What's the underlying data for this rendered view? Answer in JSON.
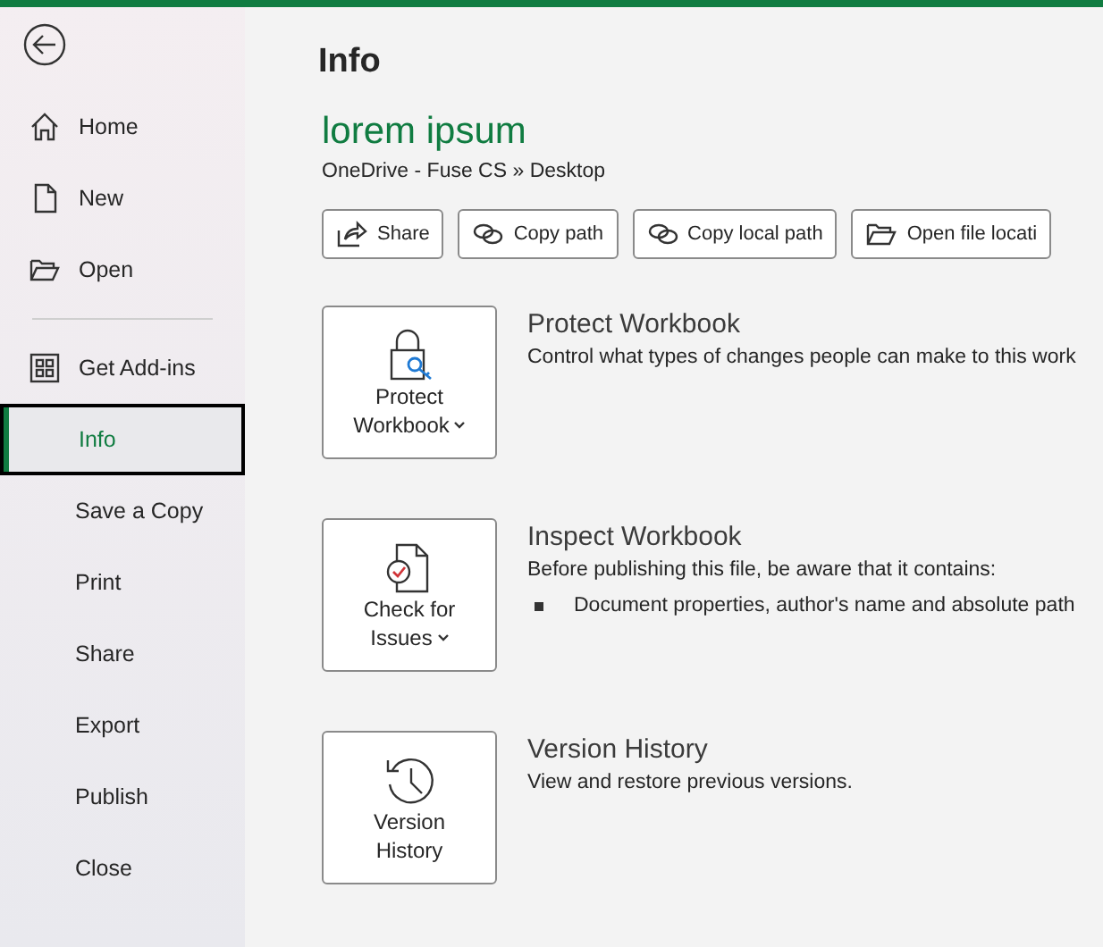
{
  "sidebar": {
    "items": [
      {
        "label": "Home",
        "selected": false
      },
      {
        "label": "New",
        "selected": false
      },
      {
        "label": "Open",
        "selected": false
      },
      {
        "kind": "divider"
      },
      {
        "label": "Get Add-ins",
        "selected": false
      },
      {
        "label": "Info",
        "selected": true
      },
      {
        "label": "Save a Copy",
        "selected": false
      },
      {
        "label": "Print",
        "selected": false
      },
      {
        "label": "Share",
        "selected": false
      },
      {
        "label": "Export",
        "selected": false
      },
      {
        "label": "Publish",
        "selected": false
      },
      {
        "label": "Close",
        "selected": false
      }
    ]
  },
  "page": {
    "title": "Info",
    "file_name": "lorem ipsum",
    "location": "OneDrive - Fuse CS » Desktop"
  },
  "actions": [
    {
      "label": "Share"
    },
    {
      "label": "Copy path"
    },
    {
      "label": "Copy local path"
    },
    {
      "label": "Open file locati"
    }
  ],
  "sections": [
    {
      "button_lines": [
        "Protect",
        "Workbook"
      ],
      "dropdown": true,
      "title": "Protect Workbook",
      "description": "Control what types of changes people can make to this work"
    },
    {
      "button_lines": [
        "Check for",
        "Issues"
      ],
      "dropdown": true,
      "title": "Inspect Workbook",
      "description": "Before publishing this file, be aware that it contains:",
      "bullets": [
        "Document properties, author's name and absolute path"
      ]
    },
    {
      "button_lines": [
        "Version",
        "History"
      ],
      "dropdown": false,
      "title": "Version History",
      "description": "View and restore previous versions."
    }
  ]
}
